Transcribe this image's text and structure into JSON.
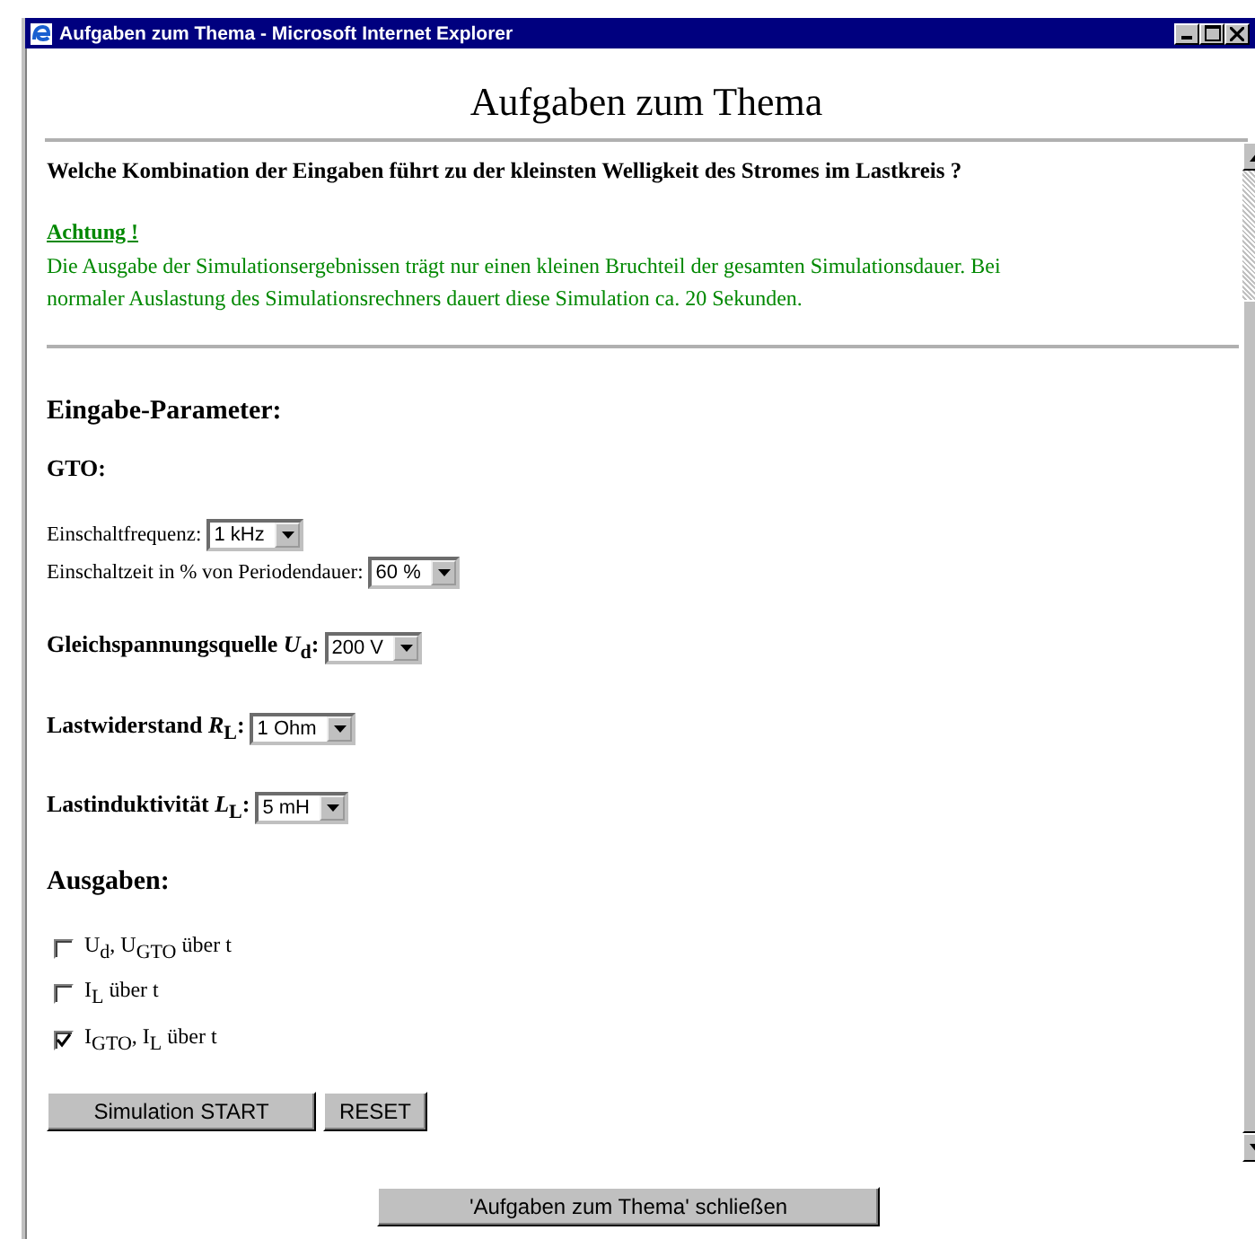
{
  "window": {
    "title": "Aufgaben zum Thema - Microsoft Internet Explorer"
  },
  "heading": "Aufgaben zum Thema",
  "question": "Welche Kombination der Eingaben führt zu der kleinsten Welligkeit des Stromes im Lastkreis ?",
  "notice": {
    "title": "Achtung !",
    "text": "Die Ausgabe der Simulationsergebnissen trägt nur einen kleinen Bruchteil der gesamten Simulationsdauer. Bei normaler Auslastung des Simulationsrechners dauert diese Simulation ca. 20 Sekunden."
  },
  "inputs": {
    "heading": "Eingabe-Parameter:",
    "gto_heading": "GTO:",
    "parameters": [
      {
        "kind": "plain",
        "label": "Einschaltfrequenz:",
        "value": "1 kHz"
      },
      {
        "kind": "plain",
        "label": "Einschaltzeit in % von Periodendauer:",
        "value": "60 %"
      },
      {
        "kind": "bold",
        "label": "Gleichspannungsquelle *U*$_{d}$:",
        "value": "200 V"
      },
      {
        "kind": "bold",
        "label": "Lastwiderstand *R*$_{L}$:",
        "value": "1 Ohm"
      },
      {
        "kind": "bold",
        "label": "Lastinduktivität *L*$_{L}$:",
        "value": "5 mH"
      }
    ]
  },
  "outputs": {
    "heading": "Ausgaben:",
    "options": [
      {
        "label": "U$_{d}$, U$_{GTO}$ über t",
        "checked": false
      },
      {
        "label": "I$_{L}$ über t",
        "checked": false
      },
      {
        "label": "I$_{GTO}$, I$_{L}$ über t",
        "checked": true
      }
    ]
  },
  "buttons": [
    "Simulation START",
    "RESET"
  ],
  "close_button": "'Aufgaben zum Thema' schließen"
}
